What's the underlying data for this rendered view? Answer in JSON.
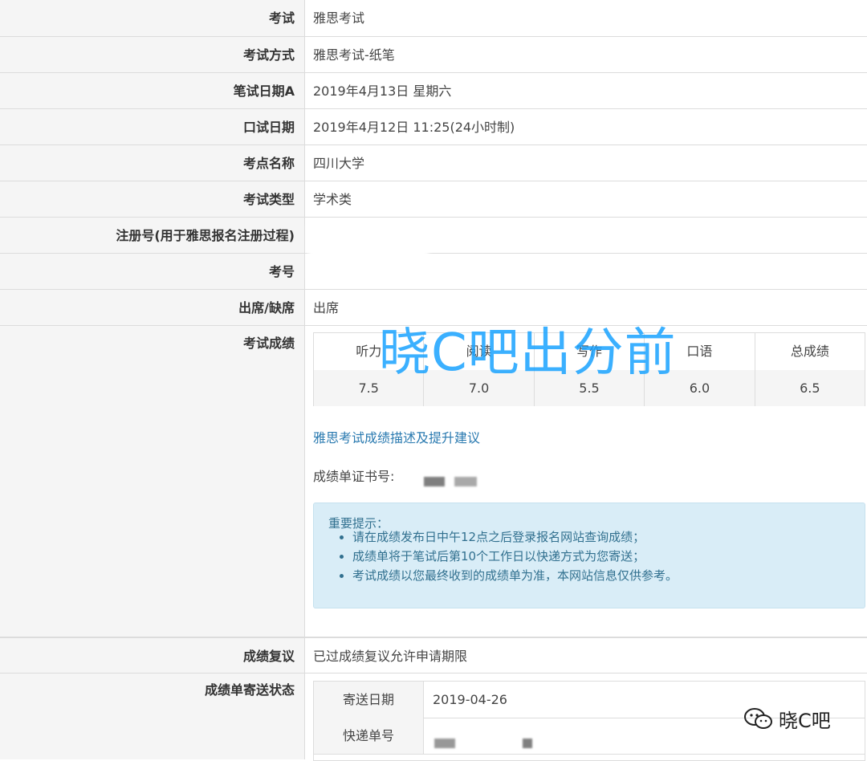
{
  "rows": {
    "exam": {
      "label": "考试",
      "value": "雅思考试"
    },
    "method": {
      "label": "考试方式",
      "value": "雅思考试-纸笔"
    },
    "written_date": {
      "label": "笔试日期A",
      "value": "2019年4月13日 星期六"
    },
    "oral_date": {
      "label": "口试日期",
      "value": "2019年4月12日 11:25(24小时制)"
    },
    "venue": {
      "label": "考点名称",
      "value": "四川大学"
    },
    "type": {
      "label": "考试类型",
      "value": "学术类"
    },
    "reg_no": {
      "label": "注册号(用于雅思报名注册过程)"
    },
    "candidate_no": {
      "label": "考号"
    },
    "attendance": {
      "label": "出席/缺席",
      "value": "出席"
    },
    "scores": {
      "label": "考试成绩"
    },
    "review": {
      "label": "成绩复议",
      "value": "已过成绩复议允许申请期限"
    },
    "shipping": {
      "label": "成绩单寄送状态"
    }
  },
  "score_table": {
    "headers": [
      "听力",
      "阅读",
      "写作",
      "口语",
      "总成绩"
    ],
    "values": [
      "7.5",
      "7.0",
      "5.5",
      "6.0",
      "6.5"
    ]
  },
  "score_link": "雅思考试成绩描述及提升建议",
  "trf_label": "成绩单证书号:",
  "notice": {
    "title": "重要提示：",
    "items": [
      "请在成绩发布日中午12点之后登录报名网站查询成绩；",
      "成绩单将于笔试后第10个工作日以快递方式为您寄送；",
      "考试成绩以您最终收到的成绩单为准，本网站信息仅供参考。"
    ]
  },
  "shipping_table": {
    "date_label": "寄送日期",
    "date_value": "2019-04-26",
    "tracking_label": "快递单号"
  },
  "watermark": "晓C吧出分前",
  "brand": "晓C吧",
  "colors": {
    "link": "#2a7ab0",
    "notice_bg": "#d9edf7",
    "watermark": "#1aa3ff"
  }
}
